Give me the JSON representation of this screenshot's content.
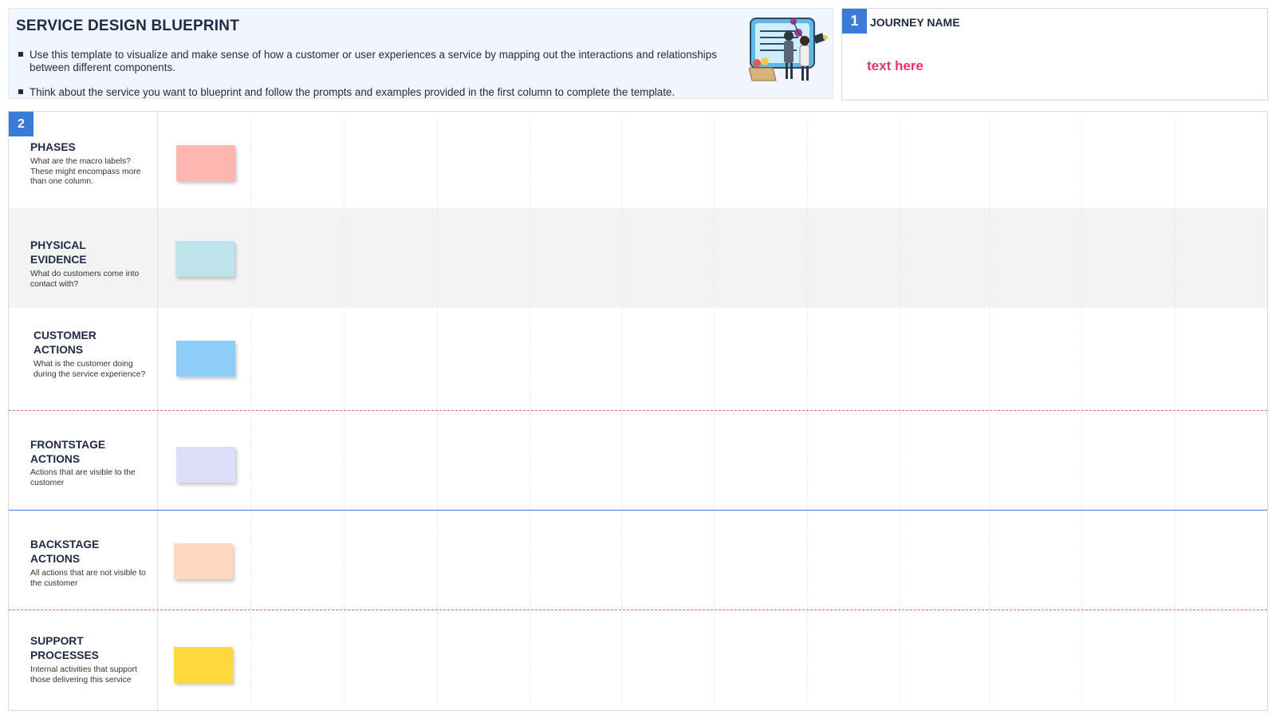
{
  "intro": {
    "title": "SERVICE DESIGN BLUEPRINT",
    "bullets": [
      "Use this template to visualize and make sense of how a customer or user experiences a service by mapping out the interactions and relationships between different components.",
      "Think about the service you want to blueprint and follow the prompts and examples provided in the first column to complete the template."
    ]
  },
  "journey": {
    "number": "1",
    "label": "JOURNEY NAME",
    "value": "text here"
  },
  "board": {
    "number": "2",
    "rows": [
      {
        "title": "PHASES",
        "desc": "What are the macro labels? These might encompass more than one column.",
        "color": "#ffb6b0"
      },
      {
        "title": "PHYSICAL EVIDENCE",
        "desc": "What do customers come into contact with?",
        "color": "#bfe3ea"
      },
      {
        "title": "CUSTOMER ACTIONS",
        "desc": "What is the customer doing during the service experience?",
        "color": "#8dcdf8"
      },
      {
        "title": "FRONTSTAGE ACTIONS",
        "desc": "Actions that are visible to the customer",
        "color": "#dcdefa"
      },
      {
        "title": "BACKSTAGE ACTIONS",
        "desc": "All actions that are not visible to the customer",
        "color": "#ffd8c0"
      },
      {
        "title": "SUPPORT PROCESSES",
        "desc": "Internal activities that support those delivering this service",
        "color": "#ffd83c"
      }
    ]
  },
  "colors": {
    "accent": "#3a7bd5",
    "highlight_text": "#e8336e",
    "line_of_interaction": "#ea6b6b",
    "line_of_visibility": "#3a7bd5"
  }
}
